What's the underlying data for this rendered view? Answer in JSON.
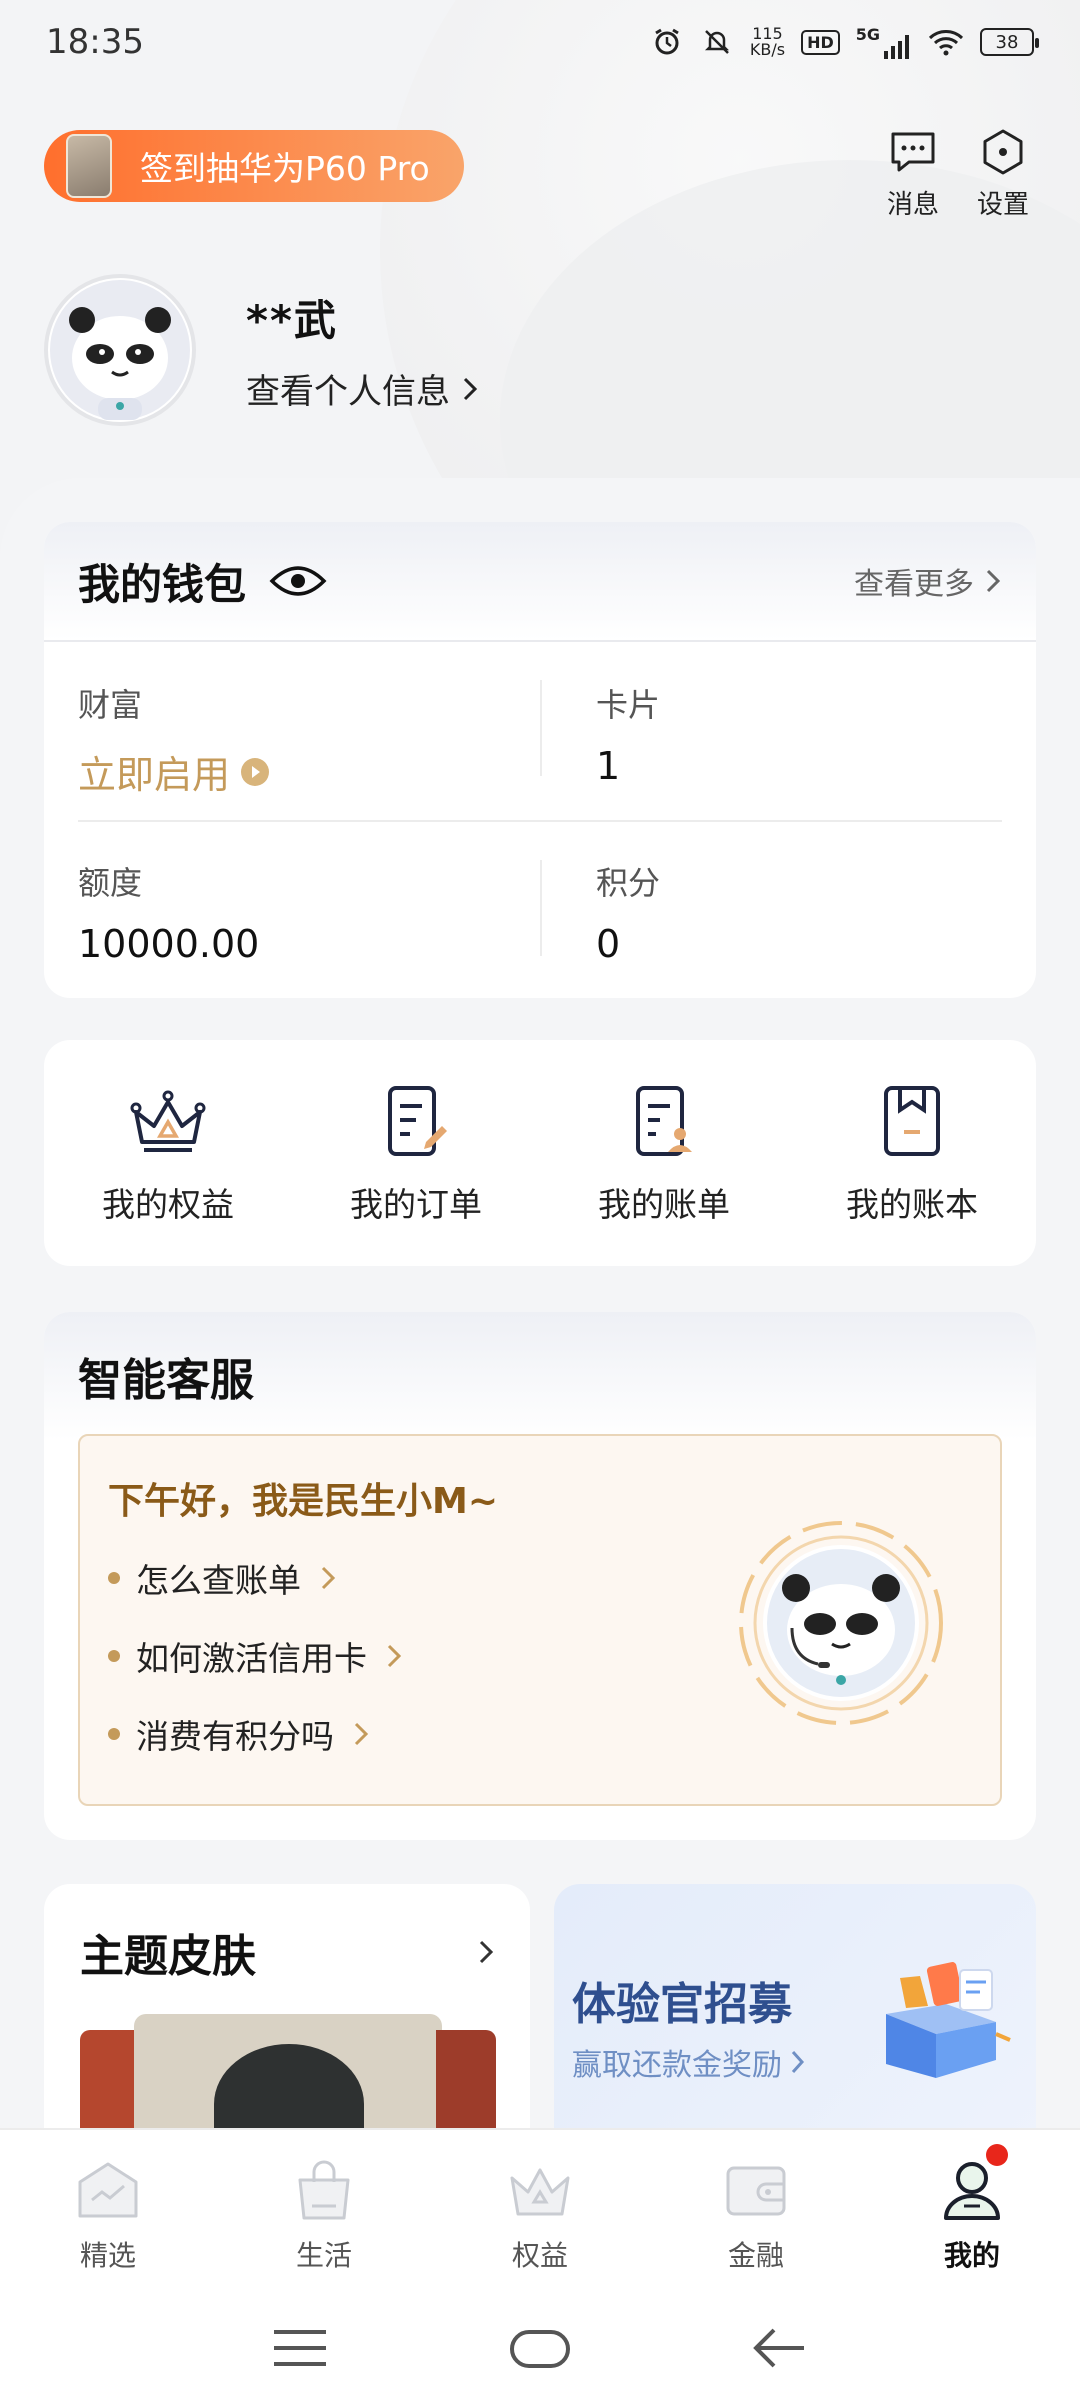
{
  "status_bar": {
    "time": "18:35",
    "net_speed_value": "115",
    "net_speed_unit": "KB/s",
    "hd": "HD",
    "network": "5G",
    "battery": "38"
  },
  "header": {
    "promo_label": "签到抽华为P60 Pro",
    "messages_label": "消息",
    "settings_label": "设置"
  },
  "profile": {
    "name": "**武",
    "view_info_label": "查看个人信息"
  },
  "wallet": {
    "title": "我的钱包",
    "more_label": "查看更多",
    "items": [
      {
        "label": "财富",
        "value": "立即启用"
      },
      {
        "label": "卡片",
        "value": "1"
      },
      {
        "label": "额度",
        "value": "10000.00"
      },
      {
        "label": "积分",
        "value": "0"
      }
    ]
  },
  "shortcuts": [
    {
      "label": "我的权益",
      "icon": "crown-icon"
    },
    {
      "label": "我的订单",
      "icon": "order-icon"
    },
    {
      "label": "我的账单",
      "icon": "bill-icon"
    },
    {
      "label": "我的账本",
      "icon": "ledger-icon"
    }
  ],
  "service": {
    "title": "智能客服",
    "greeting": "下午好，我是民生小M~",
    "questions": [
      "怎么查账单",
      "如何激活信用卡",
      "消费有积分吗"
    ]
  },
  "theme": {
    "title": "主题皮肤"
  },
  "recruit": {
    "title": "体验官招募",
    "subtitle": "赢取还款金奖励"
  },
  "bottom_nav": [
    {
      "label": "精选",
      "active": false
    },
    {
      "label": "生活",
      "active": false
    },
    {
      "label": "权益",
      "active": false
    },
    {
      "label": "金融",
      "active": false
    },
    {
      "label": "我的",
      "active": true
    }
  ],
  "colors": {
    "accent_gold": "#c49a5a",
    "promo_orange": "#ff6f2d",
    "recruit_blue": "#2f4f8f",
    "badge_red": "#e8261b"
  }
}
